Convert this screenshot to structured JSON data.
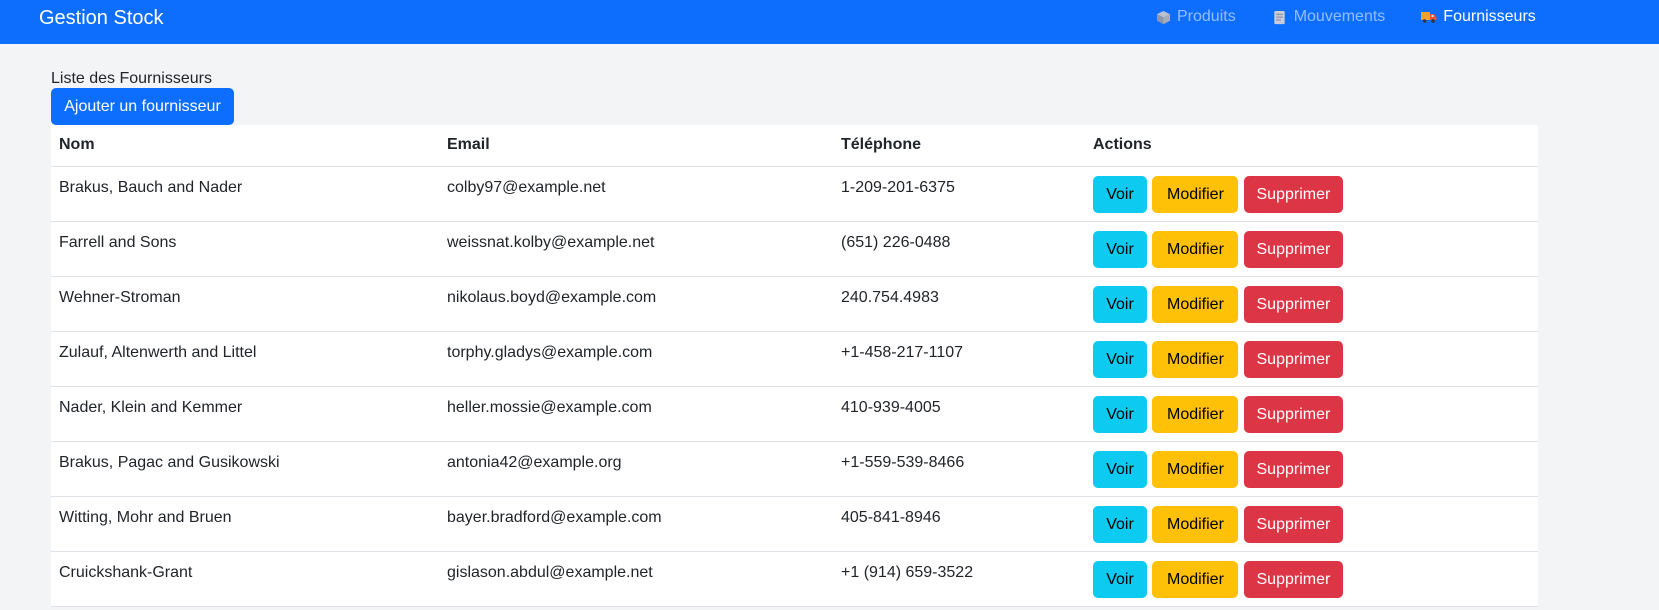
{
  "navbar": {
    "brand": "Gestion Stock",
    "items": [
      {
        "label": "Produits",
        "icon": "package-icon",
        "active": false
      },
      {
        "label": "Mouvements",
        "icon": "document-icon",
        "active": false
      },
      {
        "label": "Fournisseurs",
        "icon": "truck-icon",
        "active": true
      }
    ]
  },
  "main": {
    "title": "Liste des Fournisseurs",
    "add_button": "Ajouter un fournisseur"
  },
  "table": {
    "headers": {
      "nom": "Nom",
      "email": "Email",
      "telephone": "Téléphone",
      "actions": "Actions"
    },
    "actions": {
      "voir": "Voir",
      "modifier": "Modifier",
      "supprimer": "Supprimer"
    },
    "rows": [
      {
        "nom": "Brakus, Bauch and Nader",
        "email": "colby97@example.net",
        "telephone": "1-209-201-6375"
      },
      {
        "nom": "Farrell and Sons",
        "email": "weissnat.kolby@example.net",
        "telephone": "(651) 226-0488"
      },
      {
        "nom": "Wehner-Stroman",
        "email": "nikolaus.boyd@example.com",
        "telephone": "240.754.4983"
      },
      {
        "nom": "Zulauf, Altenwerth and Littel",
        "email": "torphy.gladys@example.com",
        "telephone": "+1-458-217-1107"
      },
      {
        "nom": "Nader, Klein and Kemmer",
        "email": "heller.mossie@example.com",
        "telephone": "410-939-4005"
      },
      {
        "nom": "Brakus, Pagac and Gusikowski",
        "email": "antonia42@example.org",
        "telephone": "+1-559-539-8466"
      },
      {
        "nom": "Witting, Mohr and Bruen",
        "email": "bayer.bradford@example.com",
        "telephone": "405-841-8946"
      },
      {
        "nom": "Cruickshank-Grant",
        "email": "gislason.abdul@example.net",
        "telephone": "+1 (914) 659-3522"
      }
    ]
  },
  "colors": {
    "navbar": "#0d6efd",
    "primary": "#0d6efd",
    "info": "#0dcaf0",
    "warning": "#ffc107",
    "danger": "#dc3545",
    "page_background": "#f3f4f6"
  }
}
